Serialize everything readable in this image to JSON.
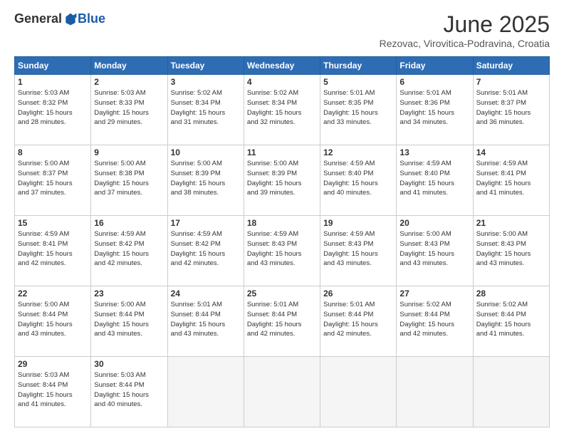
{
  "logo": {
    "general": "General",
    "blue": "Blue"
  },
  "title": "June 2025",
  "subtitle": "Rezovac, Virovitica-Podravina, Croatia",
  "header_days": [
    "Sunday",
    "Monday",
    "Tuesday",
    "Wednesday",
    "Thursday",
    "Friday",
    "Saturday"
  ],
  "weeks": [
    [
      {
        "day": "1",
        "info": "Sunrise: 5:03 AM\nSunset: 8:32 PM\nDaylight: 15 hours\nand 28 minutes."
      },
      {
        "day": "2",
        "info": "Sunrise: 5:03 AM\nSunset: 8:33 PM\nDaylight: 15 hours\nand 29 minutes."
      },
      {
        "day": "3",
        "info": "Sunrise: 5:02 AM\nSunset: 8:34 PM\nDaylight: 15 hours\nand 31 minutes."
      },
      {
        "day": "4",
        "info": "Sunrise: 5:02 AM\nSunset: 8:34 PM\nDaylight: 15 hours\nand 32 minutes."
      },
      {
        "day": "5",
        "info": "Sunrise: 5:01 AM\nSunset: 8:35 PM\nDaylight: 15 hours\nand 33 minutes."
      },
      {
        "day": "6",
        "info": "Sunrise: 5:01 AM\nSunset: 8:36 PM\nDaylight: 15 hours\nand 34 minutes."
      },
      {
        "day": "7",
        "info": "Sunrise: 5:01 AM\nSunset: 8:37 PM\nDaylight: 15 hours\nand 36 minutes."
      }
    ],
    [
      {
        "day": "8",
        "info": "Sunrise: 5:00 AM\nSunset: 8:37 PM\nDaylight: 15 hours\nand 37 minutes."
      },
      {
        "day": "9",
        "info": "Sunrise: 5:00 AM\nSunset: 8:38 PM\nDaylight: 15 hours\nand 37 minutes."
      },
      {
        "day": "10",
        "info": "Sunrise: 5:00 AM\nSunset: 8:39 PM\nDaylight: 15 hours\nand 38 minutes."
      },
      {
        "day": "11",
        "info": "Sunrise: 5:00 AM\nSunset: 8:39 PM\nDaylight: 15 hours\nand 39 minutes."
      },
      {
        "day": "12",
        "info": "Sunrise: 4:59 AM\nSunset: 8:40 PM\nDaylight: 15 hours\nand 40 minutes."
      },
      {
        "day": "13",
        "info": "Sunrise: 4:59 AM\nSunset: 8:40 PM\nDaylight: 15 hours\nand 41 minutes."
      },
      {
        "day": "14",
        "info": "Sunrise: 4:59 AM\nSunset: 8:41 PM\nDaylight: 15 hours\nand 41 minutes."
      }
    ],
    [
      {
        "day": "15",
        "info": "Sunrise: 4:59 AM\nSunset: 8:41 PM\nDaylight: 15 hours\nand 42 minutes."
      },
      {
        "day": "16",
        "info": "Sunrise: 4:59 AM\nSunset: 8:42 PM\nDaylight: 15 hours\nand 42 minutes."
      },
      {
        "day": "17",
        "info": "Sunrise: 4:59 AM\nSunset: 8:42 PM\nDaylight: 15 hours\nand 42 minutes."
      },
      {
        "day": "18",
        "info": "Sunrise: 4:59 AM\nSunset: 8:43 PM\nDaylight: 15 hours\nand 43 minutes."
      },
      {
        "day": "19",
        "info": "Sunrise: 4:59 AM\nSunset: 8:43 PM\nDaylight: 15 hours\nand 43 minutes."
      },
      {
        "day": "20",
        "info": "Sunrise: 5:00 AM\nSunset: 8:43 PM\nDaylight: 15 hours\nand 43 minutes."
      },
      {
        "day": "21",
        "info": "Sunrise: 5:00 AM\nSunset: 8:43 PM\nDaylight: 15 hours\nand 43 minutes."
      }
    ],
    [
      {
        "day": "22",
        "info": "Sunrise: 5:00 AM\nSunset: 8:44 PM\nDaylight: 15 hours\nand 43 minutes."
      },
      {
        "day": "23",
        "info": "Sunrise: 5:00 AM\nSunset: 8:44 PM\nDaylight: 15 hours\nand 43 minutes."
      },
      {
        "day": "24",
        "info": "Sunrise: 5:01 AM\nSunset: 8:44 PM\nDaylight: 15 hours\nand 43 minutes."
      },
      {
        "day": "25",
        "info": "Sunrise: 5:01 AM\nSunset: 8:44 PM\nDaylight: 15 hours\nand 42 minutes."
      },
      {
        "day": "26",
        "info": "Sunrise: 5:01 AM\nSunset: 8:44 PM\nDaylight: 15 hours\nand 42 minutes."
      },
      {
        "day": "27",
        "info": "Sunrise: 5:02 AM\nSunset: 8:44 PM\nDaylight: 15 hours\nand 42 minutes."
      },
      {
        "day": "28",
        "info": "Sunrise: 5:02 AM\nSunset: 8:44 PM\nDaylight: 15 hours\nand 41 minutes."
      }
    ],
    [
      {
        "day": "29",
        "info": "Sunrise: 5:03 AM\nSunset: 8:44 PM\nDaylight: 15 hours\nand 41 minutes."
      },
      {
        "day": "30",
        "info": "Sunrise: 5:03 AM\nSunset: 8:44 PM\nDaylight: 15 hours\nand 40 minutes."
      },
      {
        "day": "",
        "info": ""
      },
      {
        "day": "",
        "info": ""
      },
      {
        "day": "",
        "info": ""
      },
      {
        "day": "",
        "info": ""
      },
      {
        "day": "",
        "info": ""
      }
    ]
  ]
}
